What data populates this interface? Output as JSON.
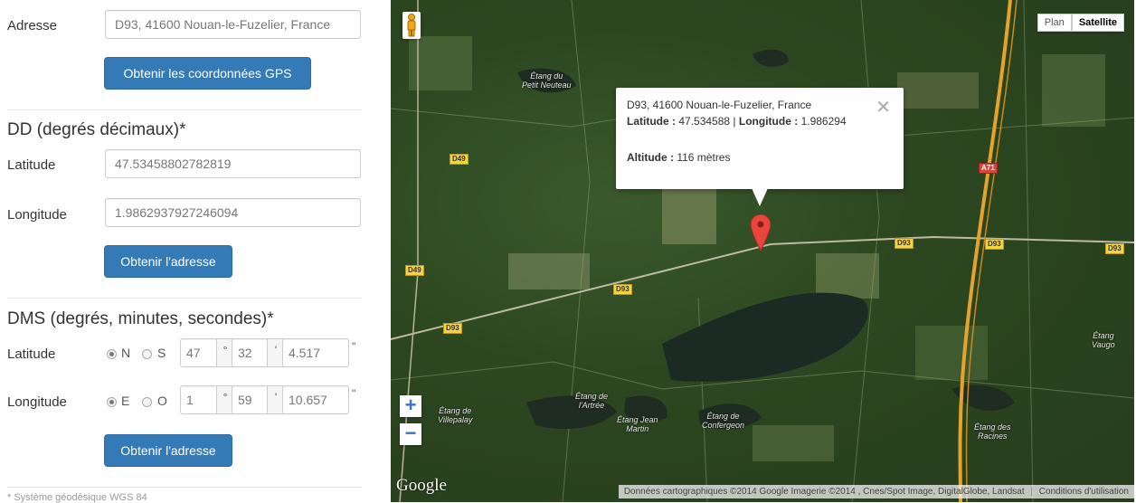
{
  "address": {
    "label": "Adresse",
    "value": "D93, 41600 Nouan-le-Fuzelier, France",
    "button": "Obtenir les coordonnées GPS"
  },
  "dd": {
    "heading": "DD (degrés décimaux)*",
    "lat_label": "Latitude",
    "lat_value": "47.53458802782819",
    "lng_label": "Longitude",
    "lng_value": "1.9862937927246094",
    "button": "Obtenir l'adresse"
  },
  "dms": {
    "heading": "DMS (degrés, minutes, secondes)*",
    "lat": {
      "label": "Latitude",
      "opt1": "N",
      "opt2": "S",
      "selected": "N",
      "deg": "47",
      "min": "32",
      "sec": "4.517"
    },
    "lng": {
      "label": "Longitude",
      "opt1": "E",
      "opt2": "O",
      "selected": "E",
      "deg": "1",
      "min": "59",
      "sec": "10.657"
    },
    "deg_unit": "°",
    "min_unit": "'",
    "sec_unit": "\"",
    "button": "Obtenir l'adresse"
  },
  "footnote": "* Système géodésique WGS 84",
  "map": {
    "type_plan": "Plan",
    "type_satellite": "Satellite",
    "active_type": "Satellite",
    "zoom_in": "+",
    "zoom_out": "−",
    "google_logo": "Google",
    "attribution": "Données cartographiques ©2014 Google Imagerie ©2014 , Cnes/Spot Image, DigitalGlobe, Landsat",
    "terms": "Conditions d'utilisation",
    "places": {
      "p1": "Étang du\nPetit Neuteau",
      "p2": "Étang de\nVillepalay",
      "p3": "Étang de\nl'Artrée",
      "p4": "Étang Jean\nMartin",
      "p5": "Étang de\nConfergeon",
      "p6": "Étang des\nRacines",
      "p7": "Étang\nVaugo"
    },
    "roads": {
      "r1": "D49",
      "r2": "D49",
      "r3": "D93",
      "r4": "D93",
      "r5": "D93",
      "r6": "D93",
      "r7": "D93",
      "r8": "A71"
    },
    "info": {
      "address": "D93, 41600 Nouan-le-Fuzelier, France",
      "lat_label": "Latitude :",
      "lat_value": "47.534588",
      "sep": "|",
      "lng_label": "Longitude :",
      "lng_value": "1.986294",
      "alt_label": "Altitude :",
      "alt_value": "116 mètres",
      "close": "✕"
    }
  }
}
